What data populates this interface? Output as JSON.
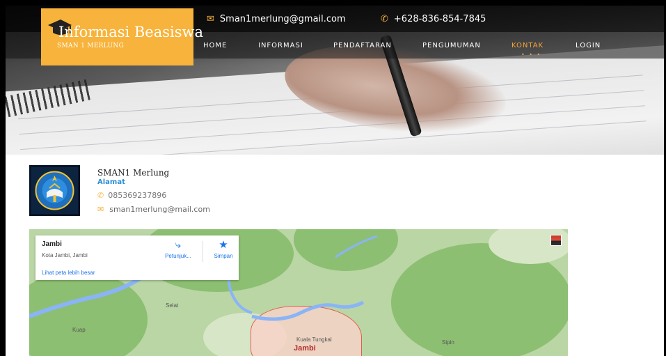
{
  "header": {
    "logo_title": "Informasi Beasiswa",
    "logo_subtitle": "SMAN 1 MERLUNG",
    "email": "Sman1merlung@gmail.com",
    "phone": "+628-836-854-7845",
    "nav": [
      {
        "label": "HOME",
        "active": false
      },
      {
        "label": "INFORMASI",
        "active": false
      },
      {
        "label": "PENDAFTARAN",
        "active": false
      },
      {
        "label": "PENGUMUMAN",
        "active": false
      },
      {
        "label": "KONTAK",
        "active": true
      },
      {
        "label": "LOGIN",
        "active": false
      }
    ],
    "accent_color": "#f7b33b"
  },
  "school": {
    "name": "SMAN1 Merlung",
    "address_label": "Alamat",
    "phone": "085369237896",
    "email": "sman1merlung@mail.com"
  },
  "map": {
    "place_title": "Jambi",
    "place_subtitle": "Kota Jambi, Jambi",
    "larger_map_link": "Lihat peta lebih besar",
    "directions_label": "Petunjuk...",
    "save_label": "Simpan",
    "labels": {
      "selat": "Selat",
      "kuap": "Kuap",
      "kuala_tungkal": "Kuala Tungkal",
      "sipin": "Sipin",
      "city": "Jambi"
    }
  }
}
